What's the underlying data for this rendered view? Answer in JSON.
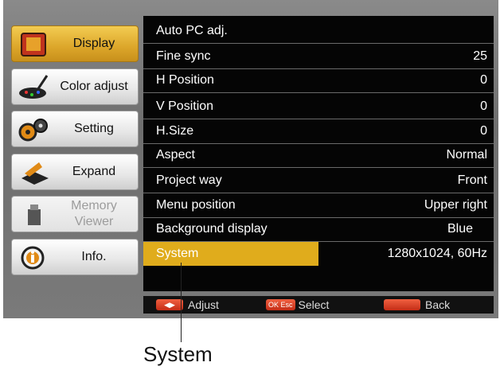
{
  "sidebar": {
    "items": [
      {
        "label": "Display",
        "icon": "display-icon",
        "state": "active"
      },
      {
        "label": "Color adjust",
        "icon": "color-adjust-icon",
        "state": "normal"
      },
      {
        "label": "Setting",
        "icon": "setting-icon",
        "state": "normal"
      },
      {
        "label": "Expand",
        "icon": "expand-icon",
        "state": "normal"
      },
      {
        "label": "Memory Viewer",
        "icon": "memory-viewer-icon",
        "state": "disabled"
      },
      {
        "label": "Info.",
        "icon": "info-icon",
        "state": "normal"
      }
    ]
  },
  "menu": {
    "rows": [
      {
        "label": "Auto PC adj.",
        "value": ""
      },
      {
        "label": "Fine sync",
        "value": "25"
      },
      {
        "label": "H Position",
        "value": "0"
      },
      {
        "label": "V Position",
        "value": "0"
      },
      {
        "label": "H.Size",
        "value": "0"
      },
      {
        "label": "Aspect",
        "value": "Normal"
      },
      {
        "label": "Project way",
        "value": "Front"
      },
      {
        "label": "Menu position",
        "value": "Upper right"
      },
      {
        "label": "Background display",
        "value": "Blue"
      },
      {
        "label": "System",
        "value": "1280x1024, 60Hz"
      }
    ],
    "selected_row": "System"
  },
  "bottom_bar": {
    "adjust_label": "Adjust",
    "select_key": "OK Esc",
    "select_label": "Select",
    "back_label": "Back"
  },
  "callout": {
    "label": "System"
  },
  "colors": {
    "highlight": "#e0ac1c",
    "menu_bg": "#050505",
    "key": "#e04a30"
  }
}
